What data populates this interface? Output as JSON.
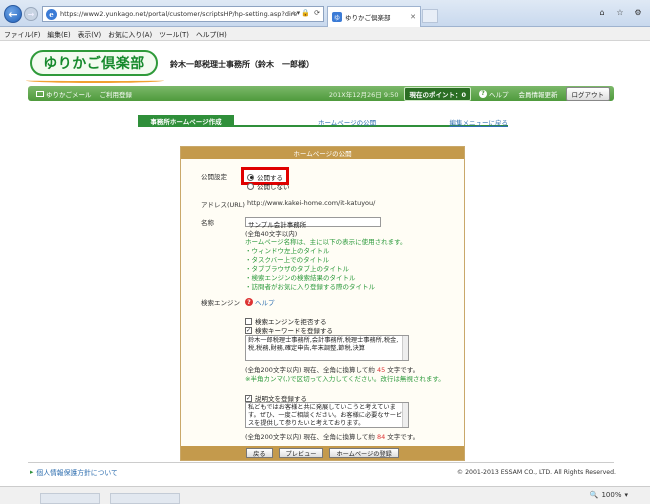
{
  "browser": {
    "url": "https://www2.yunkago.net/portal/customer/scriptsHP/hp-setting.asp?dire",
    "tab_title": "ゆりかご倶楽部",
    "menu": [
      "ファイル(F)",
      "編集(E)",
      "表示(V)",
      "お気に入り(A)",
      "ツール(T)",
      "ヘルプ(H)"
    ],
    "zoom": "100%"
  },
  "header": {
    "logo_text": "ゆりかご倶楽部",
    "firm_name": "鈴木一郎税理士事務所（鈴木　一郎様）"
  },
  "greenbar": {
    "mail_label": "ゆりかごメール",
    "guide_label": "ご利用登録",
    "date": "201X年12月26日 9:50",
    "points_label": "現在のポイント：",
    "points_value": "0",
    "help_label": "ヘルプ",
    "update_label": "会員情報更新",
    "logout_label": "ログアウト"
  },
  "tabs": {
    "active": "事務所ホームページ作成",
    "publish": "ホームページの公開",
    "back_to_menu": "編集メニューに戻る"
  },
  "panel": {
    "title": "ホームページの公開",
    "publish_label": "公開設定",
    "option_publish": "公開する",
    "option_private": "公開しない",
    "address_label": "アドレス(URL)",
    "address_value": "http://www.kakei-home.com/it-katuyou/",
    "name_label": "名称",
    "name_value": "サンプル会計事務所",
    "name_limit": "(全角40文字以内)",
    "name_notes": [
      "ホームページ名称は、主に以下の表示に使用されます。",
      "・ウィンドウ左上のタイトル",
      "・タスクバー上でのタイトル",
      "・タブブラウザのタブ上のタイトル",
      "・検索エンジンの検索結果のタイトル",
      "・訪問者がお気に入り登録する際のタイトル"
    ],
    "search_label": "検索エンジン",
    "help_label": "ヘルプ",
    "check_reject": "検索エンジンを拒否する",
    "check_keywords": "検索キーワードを登録する",
    "keywords_value": "鈴木一郎税理士事務所,会計事務所,税理士事務所,税金,税,税務,財務,確定申告,年末調整,節税,決算",
    "keywords_count_pre": "(全角200文字以内) 現在、全角に換算して約",
    "keywords_count": "45",
    "keywords_count_post": "文字です。",
    "keywords_hint": "※半角カンマ(,)で区切って入力してください。改行は無視されます。",
    "check_description": "説明文を登録する",
    "description_value": "私どもではお客様と共に発展していこうと考えています。ぜひ、一度ご相談ください。お客様に必要なサービスを提供して参りたいと考えております。",
    "desc_count_pre": "(全角200文字以内) 現在、全角に換算して約",
    "desc_count": "84",
    "desc_count_post": "文字です。",
    "btn_back": "戻る",
    "btn_preview": "プレビュー",
    "btn_register": "ホームページの登録"
  },
  "footer": {
    "privacy": "個人情報保護方針について",
    "copyright": "© 2001-2013 ESSAM CO., LTD. All Rights Reserved."
  },
  "colors": {
    "brand_green": "#2f8f3a",
    "panel_gold": "#c49a4c",
    "highlight_red": "#e00000"
  }
}
